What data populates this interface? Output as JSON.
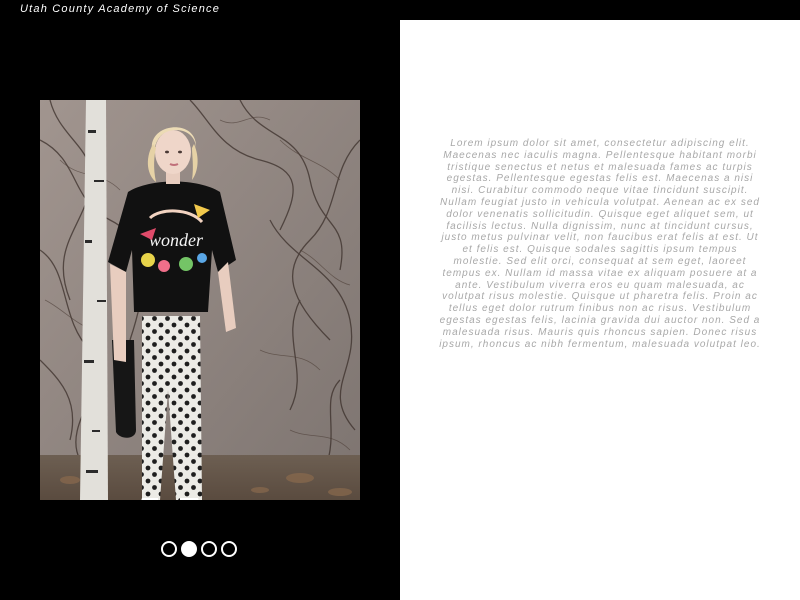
{
  "site": {
    "title": "Utah County Academy of Science"
  },
  "gallery": {
    "image_alt": "Model with platinum blonde hair wearing a black graphic cropped t-shirt and white polka-dot pants, standing in front of a wall covered with bare vines next to a birch tree, holding a black tote bag",
    "slide_count": 4,
    "active_index": 1
  },
  "content": {
    "paragraph": "Lorem ipsum dolor sit amet, consectetur adipiscing elit. Maecenas nec iaculis magna. Pellentesque habitant morbi tristique senectus et netus et malesuada fames ac turpis egestas. Pellentesque egestas felis est. Maecenas a nisi nisi. Curabitur commodo neque vitae tincidunt suscipit. Nullam feugiat justo in vehicula volutpat. Aenean ac ex sed dolor venenatis sollicitudin. Quisque eget aliquet sem, ut facilisis lectus. Nulla dignissim, nunc at tincidunt cursus, justo metus pulvinar velit, non faucibus erat felis at est. Ut et felis est. Quisque sodales sagittis ipsum tempus molestie. Sed elit orci, consequat at sem eget, laoreet tempus ex. Nullam id massa vitae ex aliquam posuere at a ante. Vestibulum viverra eros eu quam malesuada, ac volutpat risus molestie. Quisque ut pharetra felis. Proin ac tellus eget dolor rutrum finibus non ac risus. Vestibulum egestas egestas felis, lacinia gravida dui auctor non. Sed a malesuada risus. Mauris quis rhoncus sapien. Donec risus ipsum, rhoncus ac nibh fermentum, malesuada volutpat leo."
  },
  "colors": {
    "background": "#000000",
    "panel": "#ffffff",
    "body_text": "#a8a8a8"
  }
}
